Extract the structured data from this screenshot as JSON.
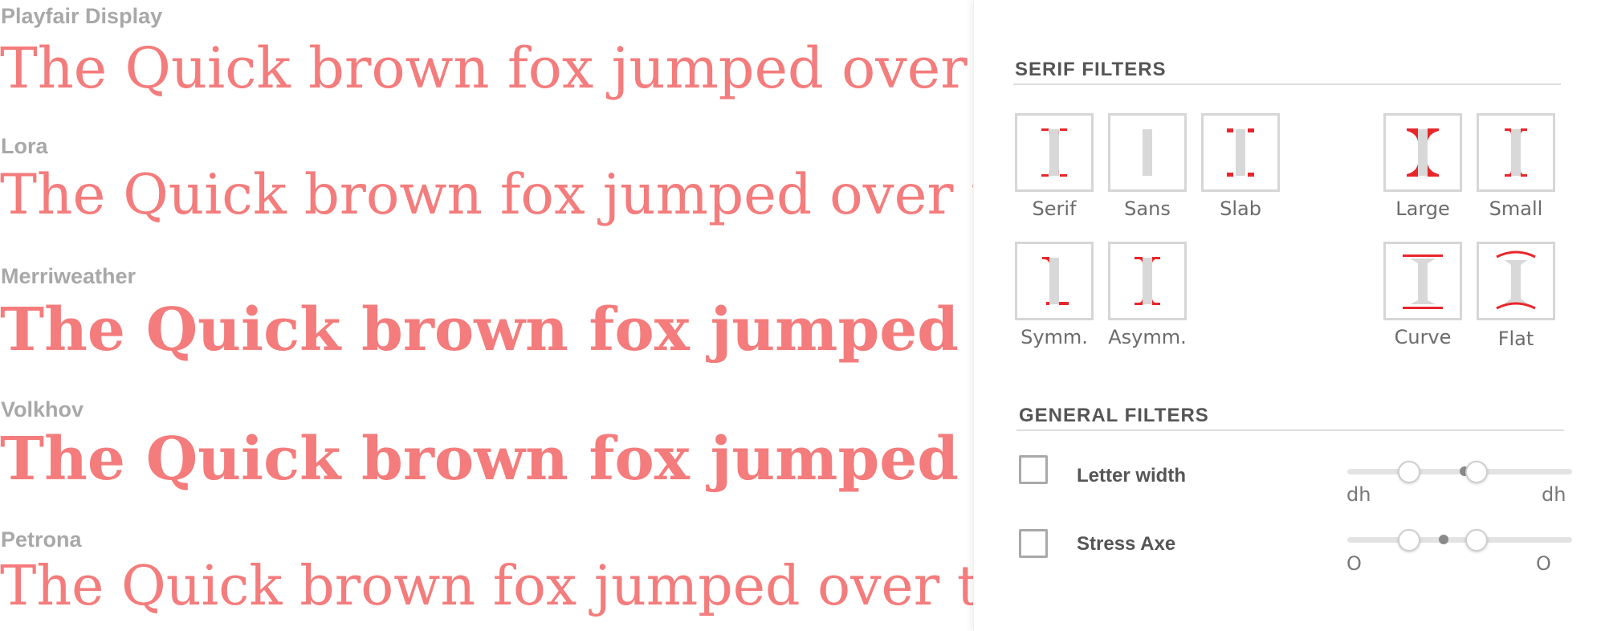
{
  "samples": [
    {
      "font_name": "Playfair Display",
      "sample_text": "The Quick brown fox jumped over the lazy dog"
    },
    {
      "font_name": "Lora",
      "sample_text": "The Quick brown fox jumped over the lazy dog"
    },
    {
      "font_name": "Merriweather",
      "sample_text": "The Quick brown fox jumped over the lazy dog"
    },
    {
      "font_name": "Volkhov",
      "sample_text": "The Quick brown fox jumped over the lazy dog"
    },
    {
      "font_name": "Petrona",
      "sample_text": "The Quick brown fox jumped over the lazy dog"
    }
  ],
  "colors": {
    "sample_text": "#f47c7c",
    "serif_accent": "#e8262b",
    "stem": "#d8d8d8"
  },
  "serif_filters": {
    "title": "SERIF FILTERS",
    "tiles": [
      {
        "label": "Serif",
        "icon": "serif-icon"
      },
      {
        "label": "Sans",
        "icon": "sans-icon"
      },
      {
        "label": "Slab",
        "icon": "slab-icon"
      },
      {
        "label": "Large",
        "icon": "large-serif-icon"
      },
      {
        "label": "Small",
        "icon": "small-serif-icon"
      },
      {
        "label": "Symm.",
        "icon": "symmetric-serif-icon"
      },
      {
        "label": "Asymm.",
        "icon": "asymmetric-serif-icon"
      },
      {
        "label": "Curve",
        "icon": "curve-serif-icon"
      },
      {
        "label": "Flat",
        "icon": "flat-serif-icon"
      }
    ]
  },
  "general_filters": {
    "title": "GENERAL FILTERS",
    "items": [
      {
        "label": "Letter width",
        "checked": false,
        "min_label": "dh",
        "max_label": "dh",
        "range": [
          0.27,
          0.57
        ],
        "marker": 0.52
      },
      {
        "label": "Stress Axe",
        "checked": false,
        "min_label": "O",
        "max_label": "O",
        "range": [
          0.27,
          0.57
        ],
        "marker": 0.43
      }
    ]
  }
}
